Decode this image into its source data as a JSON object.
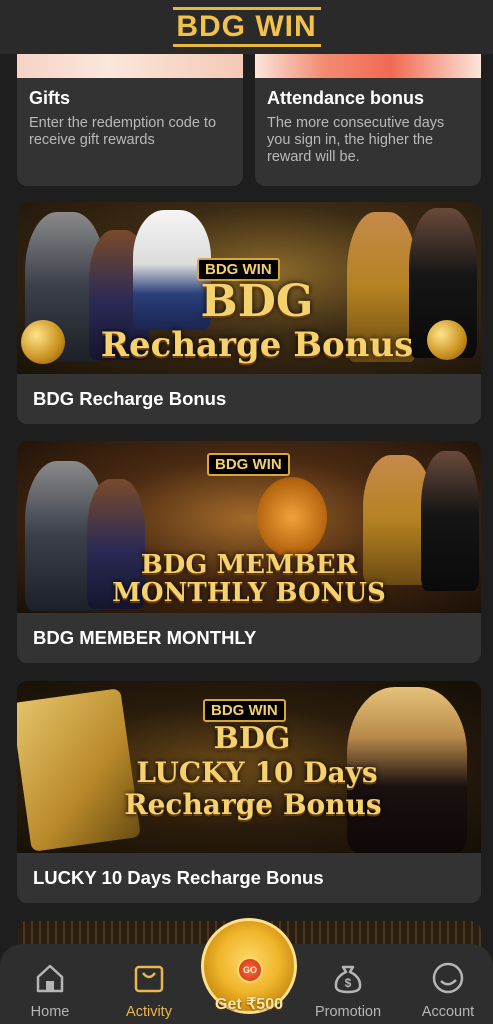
{
  "header": {
    "logo_text": "BDG WIN"
  },
  "cards": [
    {
      "title": "Gifts",
      "description": "Enter the redemption code to receive gift rewards"
    },
    {
      "title": "Attendance bonus",
      "description": "The more consecutive days you sign in, the higher the reward will be."
    }
  ],
  "promotions": [
    {
      "banner_chip": "BDG WIN",
      "banner_line1": "BDG",
      "banner_line2": "Recharge Bonus",
      "label": "BDG Recharge Bonus"
    },
    {
      "banner_chip": "BDG WIN",
      "banner_line1": "BDG MEMBER",
      "banner_line2": "MONTHLY BONUS",
      "label": "BDG MEMBER MONTHLY"
    },
    {
      "banner_chip": "BDG WIN",
      "banner_line1": "BDG",
      "banner_line2": "LUCKY 10 Days",
      "banner_line3": "Recharge Bonus",
      "label": "LUCKY 10 Days Recharge Bonus"
    }
  ],
  "nav": {
    "home": "Home",
    "activity": "Activity",
    "center_label": "Get ₹500",
    "center_badge": "GO",
    "promotion": "Promotion",
    "account": "Account"
  },
  "colors": {
    "accent": "#e9b84a",
    "background": "#1e1e1e",
    "card": "#333333"
  }
}
